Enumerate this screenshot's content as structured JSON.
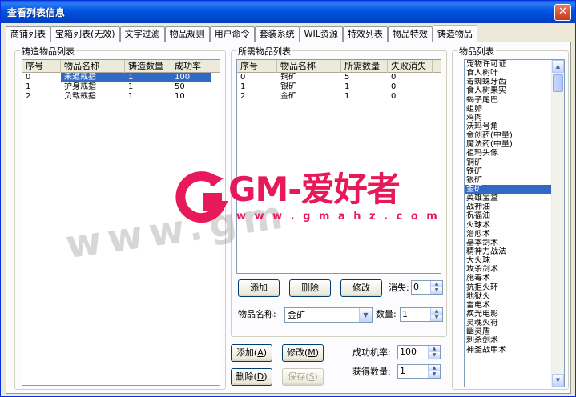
{
  "window": {
    "title": "查看列表信息",
    "close_label": "✕"
  },
  "tabs": [
    {
      "label": "商铺列表"
    },
    {
      "label": "宝箱列表(无效)"
    },
    {
      "label": "文字过滤"
    },
    {
      "label": "物品规则"
    },
    {
      "label": "用户命令"
    },
    {
      "label": "套装系统"
    },
    {
      "label": "WIL资源"
    },
    {
      "label": "特效列表"
    },
    {
      "label": "物品特效"
    },
    {
      "label": "铸造物品",
      "active": true
    }
  ],
  "forge_list": {
    "title": "铸造物品列表",
    "columns": [
      "序号",
      "物品名称",
      "铸造数量",
      "成功率"
    ],
    "rows": [
      {
        "id": "0",
        "name": "来道戒指",
        "qty": "1",
        "rate": "100",
        "selected": true
      },
      {
        "id": "1",
        "name": "护身戒指",
        "qty": "1",
        "rate": "50"
      },
      {
        "id": "2",
        "name": "负载戒指",
        "qty": "1",
        "rate": "10"
      }
    ]
  },
  "materials": {
    "title": "所需物品列表",
    "columns": [
      "序号",
      "物品名称",
      "所需数量",
      "失败消失"
    ],
    "rows": [
      {
        "id": "0",
        "name": "铜矿",
        "qty": "5",
        "lost": "0"
      },
      {
        "id": "1",
        "name": "银矿",
        "qty": "1",
        "lost": "0"
      },
      {
        "id": "2",
        "name": "金矿",
        "qty": "1",
        "lost": "0"
      }
    ],
    "add_label": "添加",
    "delete_label": "删除",
    "modify_label": "修改",
    "lost_label": "消失:",
    "lost_value": "0",
    "item_name_label": "物品名称:",
    "item_name_value": "金矿",
    "qty_label": "数量:",
    "qty_value": "1"
  },
  "forge_actions": {
    "add_label": "添加(",
    "add_key": "A",
    "modify_label": "修改(",
    "modify_key": "M",
    "delete_label": "删除(",
    "delete_key": "D",
    "save_label": "保存(",
    "save_key": "S",
    "success_rate_label": "成功机率:",
    "success_rate_value": "100",
    "get_qty_label": "获得数量:",
    "get_qty_value": "1"
  },
  "items": {
    "title": "物品列表",
    "list": [
      "宠物许可证",
      "食人树叶",
      "毒蜘蛛牙齿",
      "食人树果实",
      "蝎子尾巴",
      "蛆卵",
      "鸡肉",
      "沃玛号角",
      "金创药(中量)",
      "魔法药(中量)",
      "祖玛头像",
      "铜矿",
      "铁矿",
      "银矿",
      "金矿",
      "英雄宝盒",
      "战神油",
      "祝福油",
      "火球术",
      "治愈术",
      "基本剑术",
      "精神力战法",
      "大火球",
      "攻杀剑术",
      "施毒术",
      "抗拒火环",
      "地狱火",
      "雷电术",
      "疾光电影",
      "灵魂火符",
      "幽灵盾",
      "刺杀剑术",
      "神圣战甲术"
    ],
    "selected_index": 14
  },
  "watermark": {
    "brand": "GM-爱好者",
    "url": "w w w . g m a h z . c o m",
    "faded": "www.gm"
  }
}
